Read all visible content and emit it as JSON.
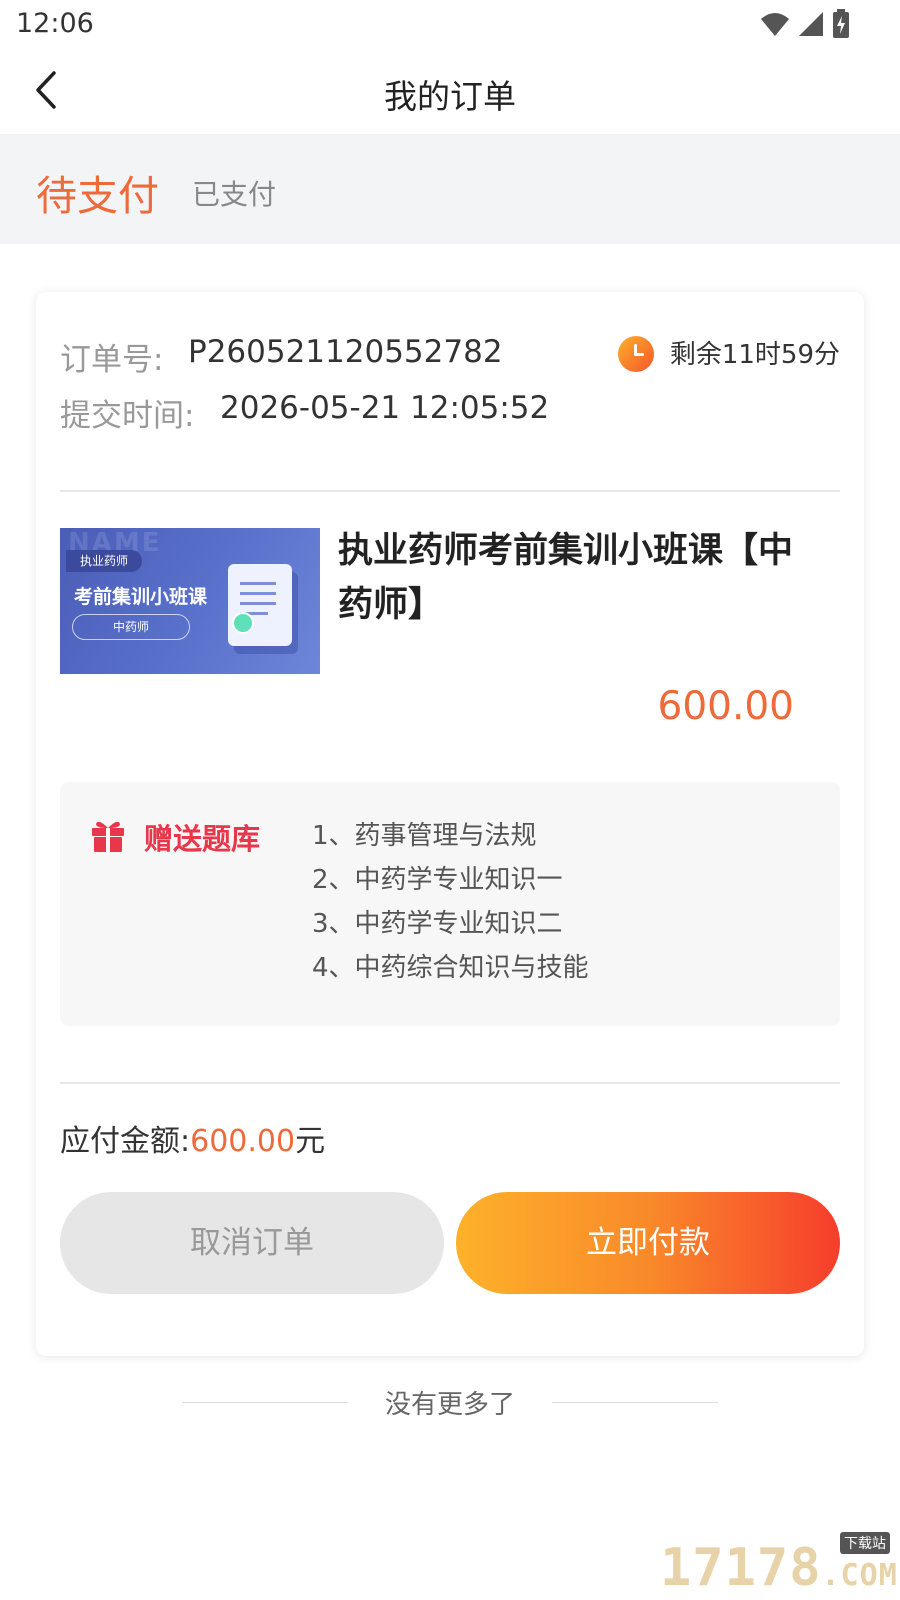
{
  "status_bar": {
    "time": "12:06",
    "icons": [
      "wifi-icon",
      "signal-icon",
      "battery-charging-icon"
    ]
  },
  "nav": {
    "title": "我的订单",
    "back_icon": "chevron-left-icon"
  },
  "tabs": [
    {
      "label": "待支付",
      "active": true
    },
    {
      "label": "已支付",
      "active": false
    }
  ],
  "order": {
    "order_no_label": "订单号:",
    "order_no": "P260521120552782",
    "submit_time_label": "提交时间:",
    "submit_time": "2026-05-21 12:05:52",
    "countdown": "剩余11时59分",
    "course": {
      "title": "执业药师考前集训小班课【中药师】",
      "price": "600.00",
      "thumbnail": {
        "tag": "执业药师",
        "title": "考前集训小班课",
        "pill": "中药师",
        "watermark": "NAME"
      }
    },
    "gift": {
      "label": "赠送题库",
      "items": [
        "1、药事管理与法规",
        "2、中药学专业知识一",
        "3、中药学专业知识二",
        "4、中药综合知识与技能"
      ]
    },
    "due_label": "应付金额:",
    "due_amount": "600.00",
    "due_unit": "元",
    "cancel_label": "取消订单",
    "pay_label": "立即付款"
  },
  "footer": {
    "no_more": "没有更多了"
  },
  "watermark": {
    "number": "17178",
    "suffix": ".COM",
    "badge": "下载站"
  },
  "colors": {
    "accent": "#ef6a3a",
    "gift_red": "#e8364a",
    "pay_gradient_start": "#fdb12a",
    "pay_gradient_end": "#f63d2c"
  }
}
